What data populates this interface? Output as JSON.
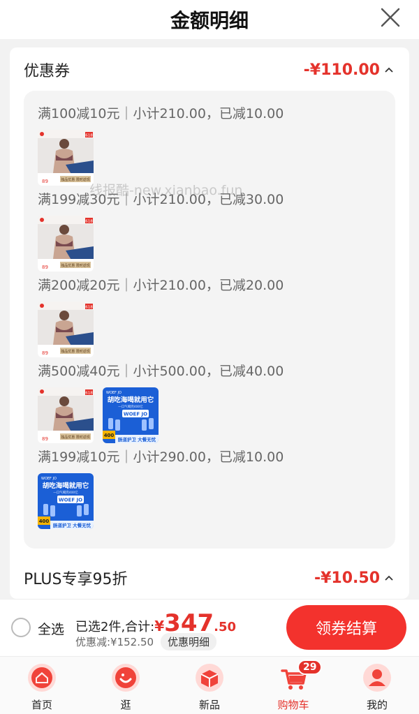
{
  "header": {
    "title": "金额明细",
    "close_icon": "close-icon"
  },
  "coupon_section": {
    "label": "优惠券",
    "amount": "-¥110.00",
    "lines": [
      {
        "text": "满100减10元｜小计210.00，已减10.00",
        "thumbs": [
          "bra-product"
        ]
      },
      {
        "text": "满199减30元｜小计210.00，已减30.00",
        "thumbs": [
          "bra-product"
        ]
      },
      {
        "text": "满200减20元｜小计210.00，已减20.00",
        "thumbs": [
          "bra-product"
        ]
      },
      {
        "text": "满500减40元｜小计500.00，已减40.00",
        "thumbs": [
          "bra-product",
          "drink-product"
        ]
      },
      {
        "text": "满199减10元｜小计290.00，已减10.00",
        "thumbs": [
          "drink-product"
        ]
      }
    ]
  },
  "plus_section": {
    "label": "PLUS专享95折",
    "amount": "-¥10.50"
  },
  "watermark": "线报酷-new.xianbao.fun",
  "product_labels": {
    "bra_badge": "618",
    "bra_footer": "独品优惠 限时返现",
    "bra_price": "89",
    "drink_brand": "WOEF JO",
    "drink_title": "胡吃海喝就用它",
    "drink_logo": "WOEF JO",
    "drink_footer": "肠道护卫 大餐无忧",
    "drink_count": "400",
    "drink_subtitle": "一口气喝完400亿"
  },
  "bottom_bar": {
    "select_all": "全选",
    "summary_prefix": "已选2件,合计:",
    "currency": "¥",
    "price_int": "347",
    "price_dec": ".50",
    "discount": "优惠减:¥152.50",
    "detail_chip": "优惠明细",
    "checkout": "领券结算"
  },
  "tabs": [
    {
      "label": "首页",
      "icon": "home-icon",
      "active": false
    },
    {
      "label": "逛",
      "icon": "browse-icon",
      "active": false
    },
    {
      "label": "新品",
      "icon": "new-products-icon",
      "active": false
    },
    {
      "label": "购物车",
      "icon": "cart-icon",
      "active": true,
      "badge": "29"
    },
    {
      "label": "我的",
      "icon": "profile-icon",
      "active": false
    }
  ],
  "colors": {
    "accent": "#e4322b",
    "button": "#f3322d",
    "background": "#f2f2f2"
  }
}
